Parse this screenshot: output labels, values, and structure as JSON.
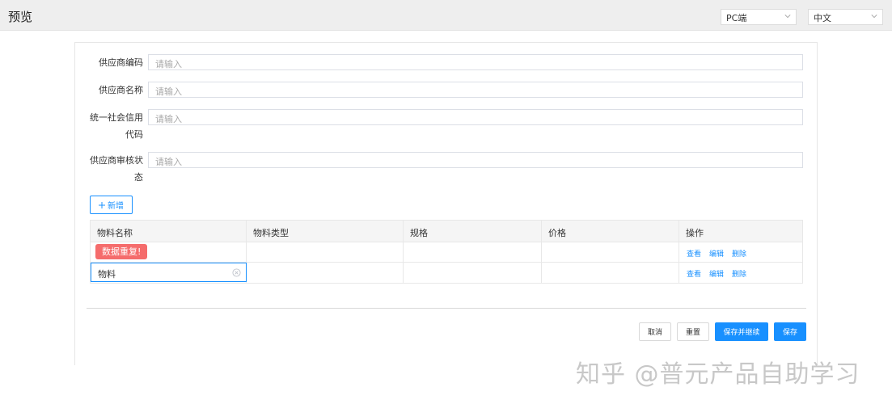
{
  "header": {
    "title": "预览"
  },
  "selects": {
    "platform": "PC端",
    "language": "中文"
  },
  "form": {
    "fields": [
      {
        "label": "供应商编码",
        "placeholder": "请输入"
      },
      {
        "label": "供应商名称",
        "placeholder": "请输入"
      },
      {
        "label": "统一社会信用代码",
        "placeholder": "请输入"
      },
      {
        "label": "供应商审核状态",
        "placeholder": "请输入"
      }
    ]
  },
  "add_button": {
    "icon": "plus-icon",
    "label": "新增"
  },
  "table": {
    "columns": [
      "物料名称",
      "物料类型",
      "规格",
      "价格",
      "操作"
    ],
    "rows": [
      {
        "error_tag": "数据重复!",
        "actions": [
          "查看",
          "编辑",
          "删除"
        ]
      },
      {
        "input_value": "物料",
        "actions": [
          "查看",
          "编辑",
          "删除"
        ]
      }
    ]
  },
  "footer_buttons": {
    "cancel": "取消",
    "reset": "重置",
    "save_continue": "保存并继续",
    "save": "保存"
  },
  "watermark": "知乎 @普元产品自助学习",
  "colors": {
    "primary": "#1890ff",
    "error": "#f56c6c"
  }
}
